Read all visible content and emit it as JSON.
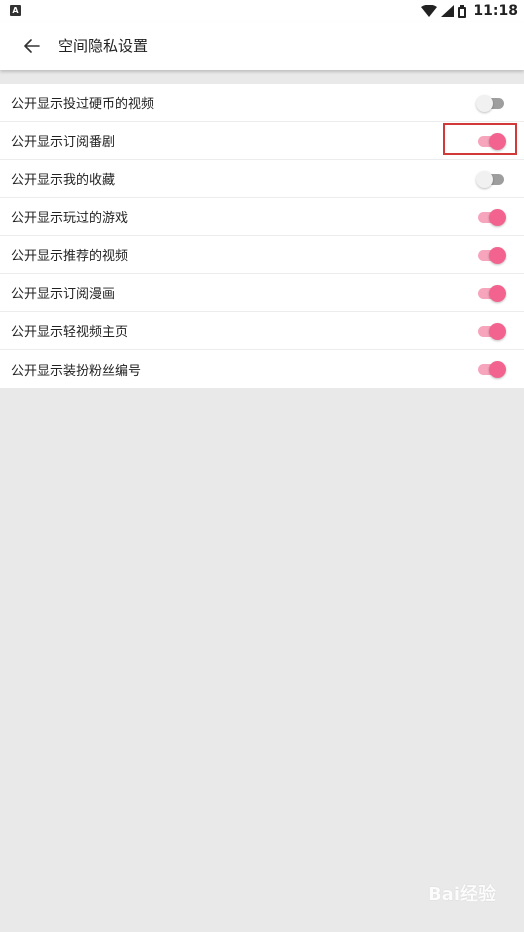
{
  "status_bar": {
    "left_icon": "A",
    "time": "11:18",
    "icons": [
      "wifi-icon",
      "signal-icon",
      "battery-icon"
    ]
  },
  "app_bar": {
    "back_icon": "arrow-left-icon",
    "title": "空间隐私设置"
  },
  "settings": [
    {
      "label": "公开显示投过硬币的视频",
      "on": false
    },
    {
      "label": "公开显示订阅番剧",
      "on": true,
      "highlighted": true
    },
    {
      "label": "公开显示我的收藏",
      "on": false
    },
    {
      "label": "公开显示玩过的游戏",
      "on": true
    },
    {
      "label": "公开显示推荐的视频",
      "on": true
    },
    {
      "label": "公开显示订阅漫画",
      "on": true
    },
    {
      "label": "公开显示轻视频主页",
      "on": true
    },
    {
      "label": "公开显示装扮粉丝编号",
      "on": true
    }
  ],
  "colors": {
    "accent": "#f2648f",
    "accent_track": "#f7a5bd",
    "highlight": "#d23a3a",
    "background": "#e9e9e9"
  },
  "watermark": "Bai经验"
}
